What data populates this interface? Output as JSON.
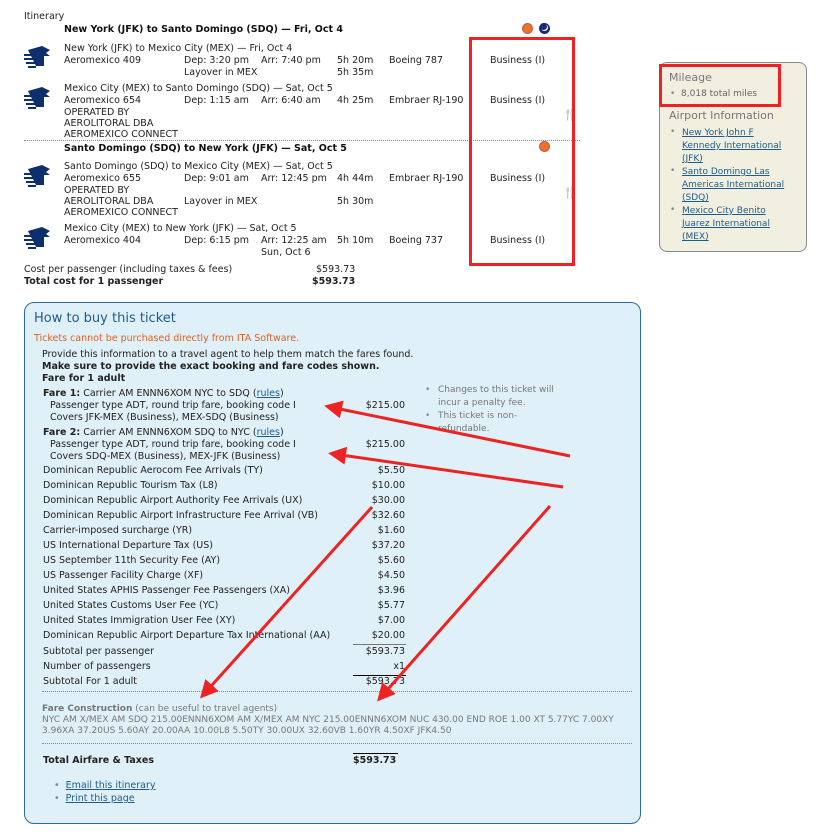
{
  "itinerary": {
    "label": "Itinerary",
    "slices": [
      {
        "title": "New York (JFK) to Santo Domingo (SDQ) — Fri, Oct 4",
        "icons": [
          "daytime-icon",
          "nighttime-icon"
        ],
        "segments": [
          {
            "route": "New York (JFK) to Mexico City (MEX) — Fri, Oct 4",
            "flight": "Aeromexico 409",
            "dep": "Dep: 3:20 pm",
            "arr": "Arr: 7:40 pm",
            "duration": "5h 20m",
            "aircraft": "Boeing 787",
            "cabin": "Business (I)",
            "layover": "Layover in MEX",
            "layover_duration": "5h 35m"
          },
          {
            "route": "Mexico City (MEX) to Santo Domingo (SDQ) — Sat, Oct 5",
            "flight": "Aeromexico 654",
            "dep": "Dep: 1:15 am",
            "arr": "Arr: 6:40 am",
            "duration": "4h 25m",
            "aircraft": "Embraer RJ-190",
            "cabin": "Business (I)",
            "operated_by": [
              "OPERATED BY",
              "AEROLITORAL DBA",
              "AEROMEXICO CONNECT"
            ],
            "meal_icon": "meal-icon"
          }
        ]
      },
      {
        "title": "Santo Domingo (SDQ) to New York (JFK) — Sat, Oct 5",
        "icons": [
          "daytime-icon"
        ],
        "segments": [
          {
            "route": "Santo Domingo (SDQ) to Mexico City (MEX) — Sat, Oct 5",
            "flight": "Aeromexico 655",
            "dep": "Dep: 9:01 am",
            "arr": "Arr: 12:45 pm",
            "duration": "4h 44m",
            "aircraft": "Embraer RJ-190",
            "cabin": "Business (I)",
            "operated_by": [
              "OPERATED BY",
              "AEROLITORAL DBA",
              "AEROMEXICO CONNECT"
            ],
            "layover": "Layover in MEX",
            "layover_duration": "5h 30m",
            "meal_icon": "meal-icon"
          },
          {
            "route": "Mexico City (MEX) to New York (JFK) — Sat, Oct 5",
            "flight": "Aeromexico 404",
            "dep": "Dep: 6:15 pm",
            "arr": "Arr: 12:25 am",
            "arr_note": "Sun, Oct 6",
            "duration": "5h 10m",
            "aircraft": "Boeing 737",
            "cabin": "Business (I)"
          }
        ]
      }
    ],
    "cost_per_passenger_label": "Cost per passenger (including taxes & fees)",
    "cost_per_passenger": "$593.73",
    "total_label": "Total cost for 1 passenger",
    "total": "$593.73"
  },
  "sidebar": {
    "mileage_title": "Mileage",
    "mileage_value": "8,018 total miles",
    "airport_title": "Airport Information",
    "airports": [
      {
        "lines": [
          "New York John F",
          "Kennedy International",
          "(JFK)"
        ]
      },
      {
        "lines": [
          "Santo Domingo Las",
          "Americas International",
          "(SDQ)"
        ]
      },
      {
        "lines": [
          "Mexico City Benito",
          "Juarez International",
          "(MEX)"
        ]
      }
    ]
  },
  "buy": {
    "title": "How to buy this ticket",
    "warning": "Tickets cannot be purchased directly from ITA Software.",
    "intro": "Provide this information to a travel agent to help them match the fares found.",
    "emphasis": "Make sure to provide the exact booking and fare codes shown.",
    "fare_for": "Fare for 1 adult",
    "fares": [
      {
        "label": "Fare 1:",
        "desc": " Carrier AM ENNN6XOM NYC to SDQ (",
        "rules": "rules",
        "close": ")",
        "detail1": "Passenger type ADT, round trip fare, booking code I",
        "detail2": "Covers JFK-MEX (Business), MEX-SDQ (Business)",
        "amount": "$215.00"
      },
      {
        "label": "Fare 2:",
        "desc": " Carrier AM ENNN6XOM SDQ to NYC (",
        "rules": "rules",
        "close": ")",
        "detail1": "Passenger type ADT, round trip fare, booking code I",
        "detail2": "Covers SDQ-MEX (Business), MEX-JFK (Business)",
        "amount": "$215.00"
      }
    ],
    "notes": [
      "Changes to this ticket will incur a penalty fee.",
      "This ticket is non-refundable."
    ],
    "taxes": [
      {
        "name": "Dominican Republic Aerocom Fee Arrivals (TY)",
        "amount": "$5.50"
      },
      {
        "name": "Dominican Republic Tourism Tax (L8)",
        "amount": "$10.00"
      },
      {
        "name": "Dominican Republic Airport Authority Fee Arrivals (UX)",
        "amount": "$30.00"
      },
      {
        "name": "Dominican Republic Airport Infrastructure Fee Arrival (VB)",
        "amount": "$32.60"
      },
      {
        "name": "Carrier-imposed surcharge (YR)",
        "amount": "$1.60"
      },
      {
        "name": "US International Departure Tax (US)",
        "amount": "$37.20"
      },
      {
        "name": "US September 11th Security Fee (AY)",
        "amount": "$5.60"
      },
      {
        "name": "US Passenger Facility Charge (XF)",
        "amount": "$4.50"
      },
      {
        "name": "United States APHIS Passenger Fee Passengers (XA)",
        "amount": "$3.96"
      },
      {
        "name": "United States Customs User Fee (YC)",
        "amount": "$5.77"
      },
      {
        "name": "United States Immigration User Fee (XY)",
        "amount": "$7.00"
      },
      {
        "name": "Dominican Republic Airport Departure Tax International (AA)",
        "amount": "$20.00"
      }
    ],
    "subtotal_label": "Subtotal per passenger",
    "subtotal": "$593.73",
    "passengers_label": "Number of passengers",
    "passengers": "x1",
    "subtotal_adult_label": "Subtotal For 1 adult",
    "subtotal_adult": "$593.73",
    "fare_construction_label": "Fare Construction",
    "fare_construction_note": " (can be useful to travel agents)",
    "fare_construction_line1": "NYC AM X/MEX AM SDQ 215.00ENNN6XOM AM X/MEX AM NYC 215.00ENNN6XOM NUC 430.00 END ROE 1.00 XT 5.77YC 7.00XY",
    "fare_construction_line2": "3.96XA 37.20US 5.60AY 20.00AA 10.00L8 5.50TY 30.00UX 32.60VB 1.60YR 4.50XF JFK4.50",
    "total_label": "Total Airfare & Taxes",
    "total": "$593.73",
    "links": [
      "Email this itinerary",
      "Print this page"
    ]
  },
  "annotations": {
    "highlight_color": "#ee2222"
  }
}
